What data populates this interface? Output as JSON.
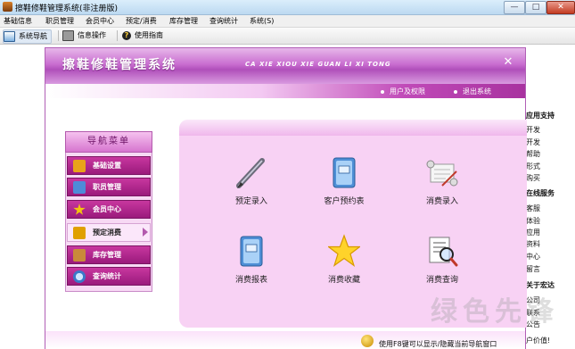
{
  "window": {
    "title": "擦鞋修鞋管理系统(非注册版)",
    "min_label": "—",
    "max_label": "□",
    "close_label": "✕"
  },
  "menubar": [
    "基础信息",
    "职员管理",
    "会员中心",
    "预定/消费",
    "库存管理",
    "查询统计",
    "系统(S)"
  ],
  "toolbar": {
    "nav_label": "系统导航",
    "info_label": "信息操作",
    "help_label": "使用指南",
    "help_glyph": "?"
  },
  "dialog": {
    "title": "擦鞋修鞋管理系统",
    "subtitle": "CA XIE XIOU XIE GUAN LI XI TONG",
    "close_label": "✕",
    "links": [
      "用户及权限",
      "退出系统"
    ]
  },
  "nav_menu": {
    "header": "导航菜单",
    "items": [
      {
        "label": "基础设置",
        "icon": "book-icon",
        "color": "#e9a21a"
      },
      {
        "label": "职员管理",
        "icon": "id-card-icon",
        "color": "#4e8bd8"
      },
      {
        "label": "会员中心",
        "icon": "star-icon",
        "color": "#f1c40f"
      },
      {
        "label": "预定消费",
        "icon": "coins-icon",
        "color": "#e0a000"
      },
      {
        "label": "库存管理",
        "icon": "box-icon",
        "color": "#c98a3a"
      },
      {
        "label": "查询统计",
        "icon": "magnifier-icon",
        "color": "#3a78c8"
      }
    ],
    "active_index": 3
  },
  "features": [
    {
      "label": "预定录入",
      "icon": "pen-icon"
    },
    {
      "label": "客户预约表",
      "icon": "report-book-icon"
    },
    {
      "label": "消费录入",
      "icon": "scroll-icon"
    },
    {
      "label": "消费报表",
      "icon": "report-book-icon"
    },
    {
      "label": "消费收藏",
      "icon": "star-icon"
    },
    {
      "label": "消费查询",
      "icon": "search-document-icon"
    }
  ],
  "right_panel": {
    "lines": [
      "应用支持",
      "开发",
      "开发",
      "帮助",
      "形式",
      "购买",
      "在线服务",
      "客服",
      "体验",
      "应用",
      "资料",
      "中心",
      "留言",
      "关于宏达",
      "公司",
      "联系",
      "公告",
      "户价值!"
    ]
  },
  "status_text": "使用F8键可以显示/隐藏当前导航窗口",
  "watermark": "绿色先锋"
}
